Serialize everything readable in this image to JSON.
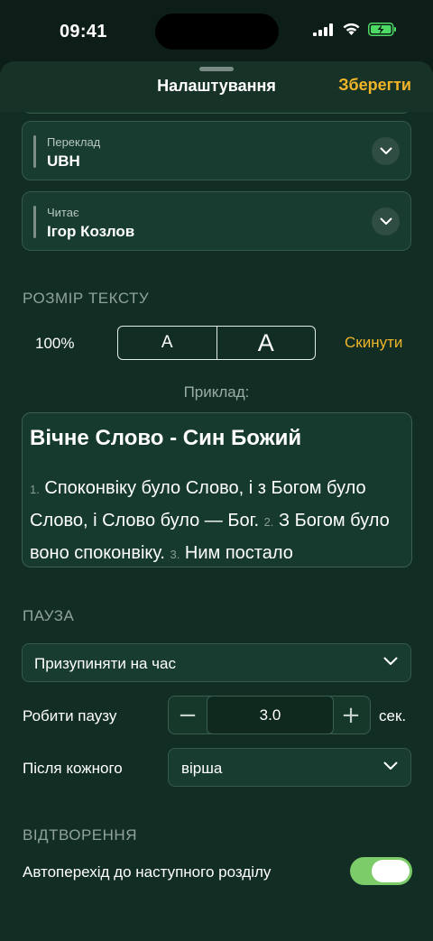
{
  "status": {
    "time": "09:41",
    "icons": [
      "signal-icon",
      "wifi-icon",
      "battery-charging-icon"
    ],
    "battery_color": "#4cd964"
  },
  "header": {
    "title": "Налаштування",
    "save_label": "Зберегти"
  },
  "translation": {
    "label": "Переклад",
    "value": "UBH"
  },
  "reader": {
    "label": "Читає",
    "value": "Ігор Козлов"
  },
  "text_size": {
    "section_title": "РОЗМІР ТЕКСТУ",
    "percent": "100%",
    "decrease_label": "A",
    "increase_label": "A",
    "reset_label": "Скинути",
    "example_label": "Приклад:"
  },
  "preview": {
    "title": "Вічне Слово - Син Божий",
    "verses": [
      {
        "num": "1.",
        "text": "Споконвіку було Слово, і з Богом було Слово, і Слово було — Бог."
      },
      {
        "num": "2.",
        "text": "З Богом було воно споконвіку."
      },
      {
        "num": "3.",
        "text": "Ним постало"
      }
    ]
  },
  "pause": {
    "section_title": "ПАУЗА",
    "mode_value": "Призупиняти на час",
    "duration_label": "Робити паузу",
    "duration_value": "3.0",
    "minus_label": "−",
    "plus_label": "+",
    "unit": "сек.",
    "after_label": "Після кожного",
    "after_value": "вірша"
  },
  "playback": {
    "section_title": "ВІДТВОРЕННЯ",
    "autoadvance_label": "Автоперехід до наступного розділу",
    "autoadvance_on": true
  },
  "colors": {
    "accent": "#f0b429",
    "toggle_on": "#7dcc6a",
    "background": "#122d24"
  }
}
